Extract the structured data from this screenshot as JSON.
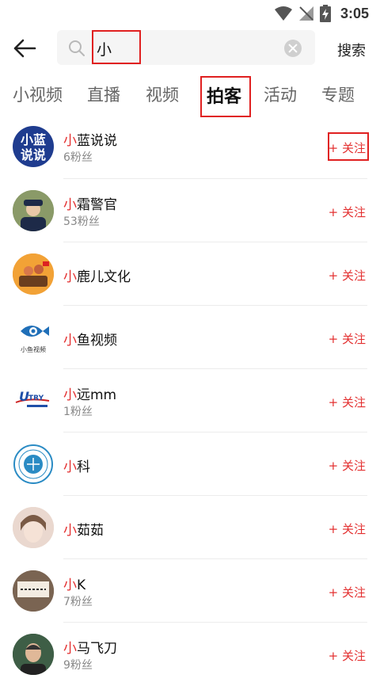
{
  "status_bar": {
    "time": "3:05"
  },
  "search": {
    "query": "小",
    "submit_label": "搜索"
  },
  "tabs": [
    {
      "label": "小视频"
    },
    {
      "label": "直播"
    },
    {
      "label": "视频"
    },
    {
      "label": "拍客"
    },
    {
      "label": "活动"
    },
    {
      "label": "专题"
    }
  ],
  "results": [
    {
      "hit": "小",
      "rest": "蓝说说",
      "fans": "6粉丝",
      "follow": "+ 关注",
      "avatar_text": "小蓝说说"
    },
    {
      "hit": "小",
      "rest": "霜警官",
      "fans": "53粉丝",
      "follow": "+ 关注"
    },
    {
      "hit": "小",
      "rest": "鹿儿文化",
      "fans": "",
      "follow": "+ 关注"
    },
    {
      "hit": "小",
      "rest": "鱼视频",
      "fans": "",
      "follow": "+ 关注",
      "avatar_text": "小鱼视频"
    },
    {
      "hit": "小",
      "rest": "远mm",
      "fans": "1粉丝",
      "follow": "+ 关注",
      "avatar_text": "TRY"
    },
    {
      "hit": "小",
      "rest": "科",
      "fans": "",
      "follow": "+ 关注"
    },
    {
      "hit": "小",
      "rest": "茹茹",
      "fans": "",
      "follow": "+ 关注"
    },
    {
      "hit": "小",
      "rest": "K",
      "fans": "7粉丝",
      "follow": "+ 关注"
    },
    {
      "hit": "小",
      "rest": "马飞刀",
      "fans": "9粉丝",
      "follow": "+ 关注"
    }
  ],
  "colors": {
    "accent": "#e33030",
    "highlight_box": "#e02020"
  }
}
